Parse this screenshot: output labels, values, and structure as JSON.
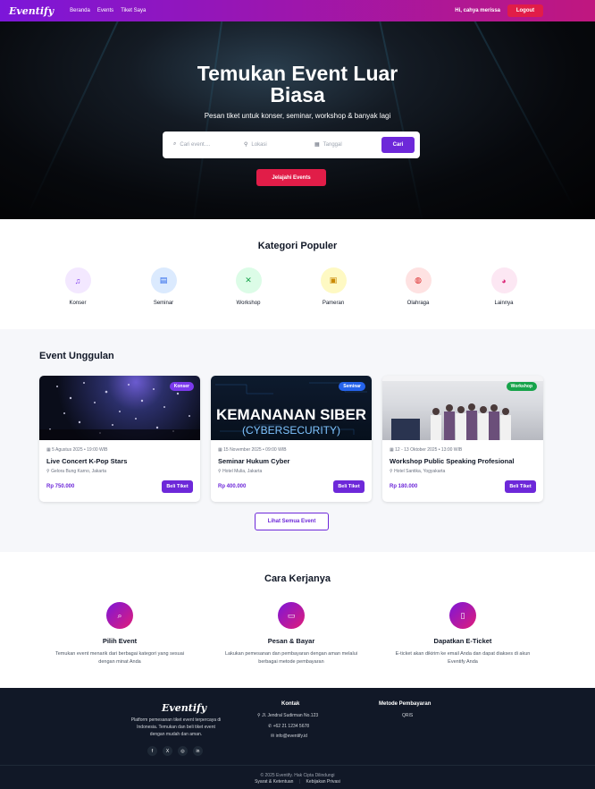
{
  "nav": {
    "logo": "Eventify",
    "links": [
      "Beranda",
      "Events",
      "Tiket Saya"
    ],
    "greeting": "Hi, cahya merissa",
    "logout": "Logout"
  },
  "hero": {
    "title_line1": "Temukan Event Luar",
    "title_line2": "Biasa",
    "subtitle": "Pesan tiket untuk konser, seminar, workshop & banyak lagi",
    "search_placeholder": "Cari event....",
    "location_placeholder": "Lokasi",
    "date_placeholder": "Tanggal",
    "search_button": "Cari",
    "explore_button": "Jelajahi Events"
  },
  "categories": {
    "title": "Kategori Populer",
    "items": [
      {
        "label": "Konser",
        "icon": "music-icon",
        "glyph": "♫",
        "bg": "#f3e8ff",
        "fg": "#7c3aed"
      },
      {
        "label": "Seminar",
        "icon": "presentation-icon",
        "glyph": "▤",
        "bg": "#dbeafe",
        "fg": "#2563eb"
      },
      {
        "label": "Workshop",
        "icon": "tools-icon",
        "glyph": "✕",
        "bg": "#dcfce7",
        "fg": "#16a34a"
      },
      {
        "label": "Pameran",
        "icon": "image-icon",
        "glyph": "▣",
        "bg": "#fef9c3",
        "fg": "#ca8a04"
      },
      {
        "label": "Olahraga",
        "icon": "ball-icon",
        "glyph": "◍",
        "bg": "#fee2e2",
        "fg": "#dc2626"
      },
      {
        "label": "Lainnya",
        "icon": "palette-icon",
        "glyph": "◕",
        "bg": "#fce7f3",
        "fg": "#db2777"
      }
    ]
  },
  "featured": {
    "title": "Event Unggulan",
    "events": [
      {
        "badge": "Konser",
        "badge_color": "#7c3aed",
        "date": "5 Agustus 2025 • 19:00 WIB",
        "name": "Live Concert K-Pop Stars",
        "location": "Gelora Bung Karno, Jakarta",
        "price": "Rp 750.000",
        "button": "Beli Tiket"
      },
      {
        "badge": "Seminar",
        "badge_color": "#2563eb",
        "date": "15 November 2025 • 09:00 WIB",
        "name": "Seminar Hukum Cyber",
        "location": "Hotel Mulia, Jakarta",
        "price": "Rp 400.000",
        "button": "Beli Tiket",
        "image_line1": "KEMANANAN SIBER",
        "image_line2": "(CYBERSECURITY)"
      },
      {
        "badge": "Workshop",
        "badge_color": "#16a34a",
        "date": "12 - 13 Oktober 2025 • 13:00 WIB",
        "name": "Workshop Public Speaking Profesional",
        "location": "Hotel Santika, Yogyakarta",
        "price": "Rp 180.000",
        "button": "Beli Tiket"
      }
    ],
    "view_all": "Lihat Semua Event"
  },
  "how": {
    "title": "Cara Kerjanya",
    "steps": [
      {
        "title": "Pilih Event",
        "icon": "search-icon",
        "desc1": "Temukan event menarik dari berbagai kategori yang sesuai",
        "desc2": "dengan minat Anda"
      },
      {
        "title": "Pesan & Bayar",
        "icon": "card-icon",
        "desc1": "Lakukan pemesanan dan pembayaran dengan aman melalui",
        "desc2": "berbagai metode pembayaran"
      },
      {
        "title": "Dapatkan E-Ticket",
        "icon": "ticket-icon",
        "desc1": "E-ticket akan dikirim ke email Anda dan dapat diakses di akun",
        "desc2": "Eventify Anda"
      }
    ]
  },
  "footer": {
    "logo": "Eventify",
    "desc1": "Platform pemesanan tiket event terpercaya di",
    "desc2": "Indonesia. Temukan dan beli tiket event",
    "desc3": "dengan mudah dan aman.",
    "social": [
      "f",
      "X",
      "◎",
      "in"
    ],
    "contact_title": "Kontak",
    "address": "Jl. Jendral Sudirman No.123",
    "phone": "+62 21 1234 5678",
    "email": "info@eventify.id",
    "payment_title": "Metode Pembayaran",
    "payment": "QRIS",
    "copyright": "© 2025 Eventify. Hak Cipta Dilindungi",
    "terms": "Syarat & Ketentuan",
    "privacy": "Kebijakan Privasi"
  }
}
